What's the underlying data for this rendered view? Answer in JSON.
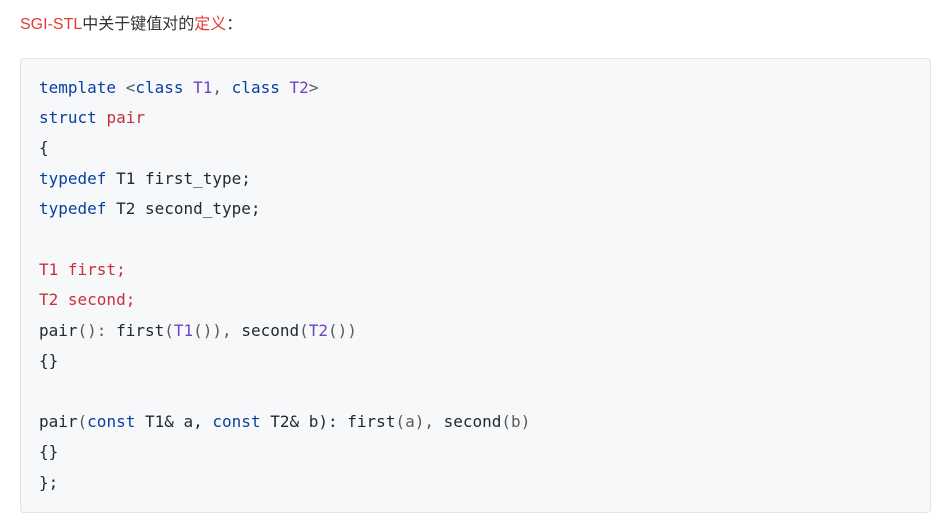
{
  "heading": {
    "part1": "SGI-STL",
    "part2": "中关于键值对的",
    "part3": "定义",
    "part4": "："
  },
  "code": {
    "l1": {
      "a": "template",
      "b": " <",
      "c": "class",
      "d": " ",
      "e": "T1",
      "f": ", ",
      "g": "class",
      "h": " ",
      "i": "T2",
      "j": ">"
    },
    "l2": {
      "a": "struct",
      "b": " ",
      "c": "pair"
    },
    "l3": {
      "a": "{"
    },
    "l4": {
      "a": "typedef",
      "b": " T1 first_type;"
    },
    "l5": {
      "a": "typedef",
      "b": " T2 second_type;"
    },
    "l6": {
      "a": ""
    },
    "l7": {
      "a": "T1 first;"
    },
    "l8": {
      "a": "T2 second;"
    },
    "l9": {
      "a": "pair",
      "b": "(): ",
      "c": "first",
      "d": "(",
      "e": "T1",
      "f": "()), ",
      "g": "second",
      "h": "(",
      "i": "T2",
      "j": "())"
    },
    "l10": {
      "a": "{}"
    },
    "l11": {
      "a": ""
    },
    "l12": {
      "a": "pair",
      "b": "(",
      "c": "const",
      "d": " T1& a, ",
      "e": "const",
      "f": " T2& b): ",
      "g": "first",
      "h": "(a), ",
      "i": "second",
      "j": "(b)"
    },
    "l13": {
      "a": "{}"
    },
    "l14": {
      "a": "};"
    }
  }
}
